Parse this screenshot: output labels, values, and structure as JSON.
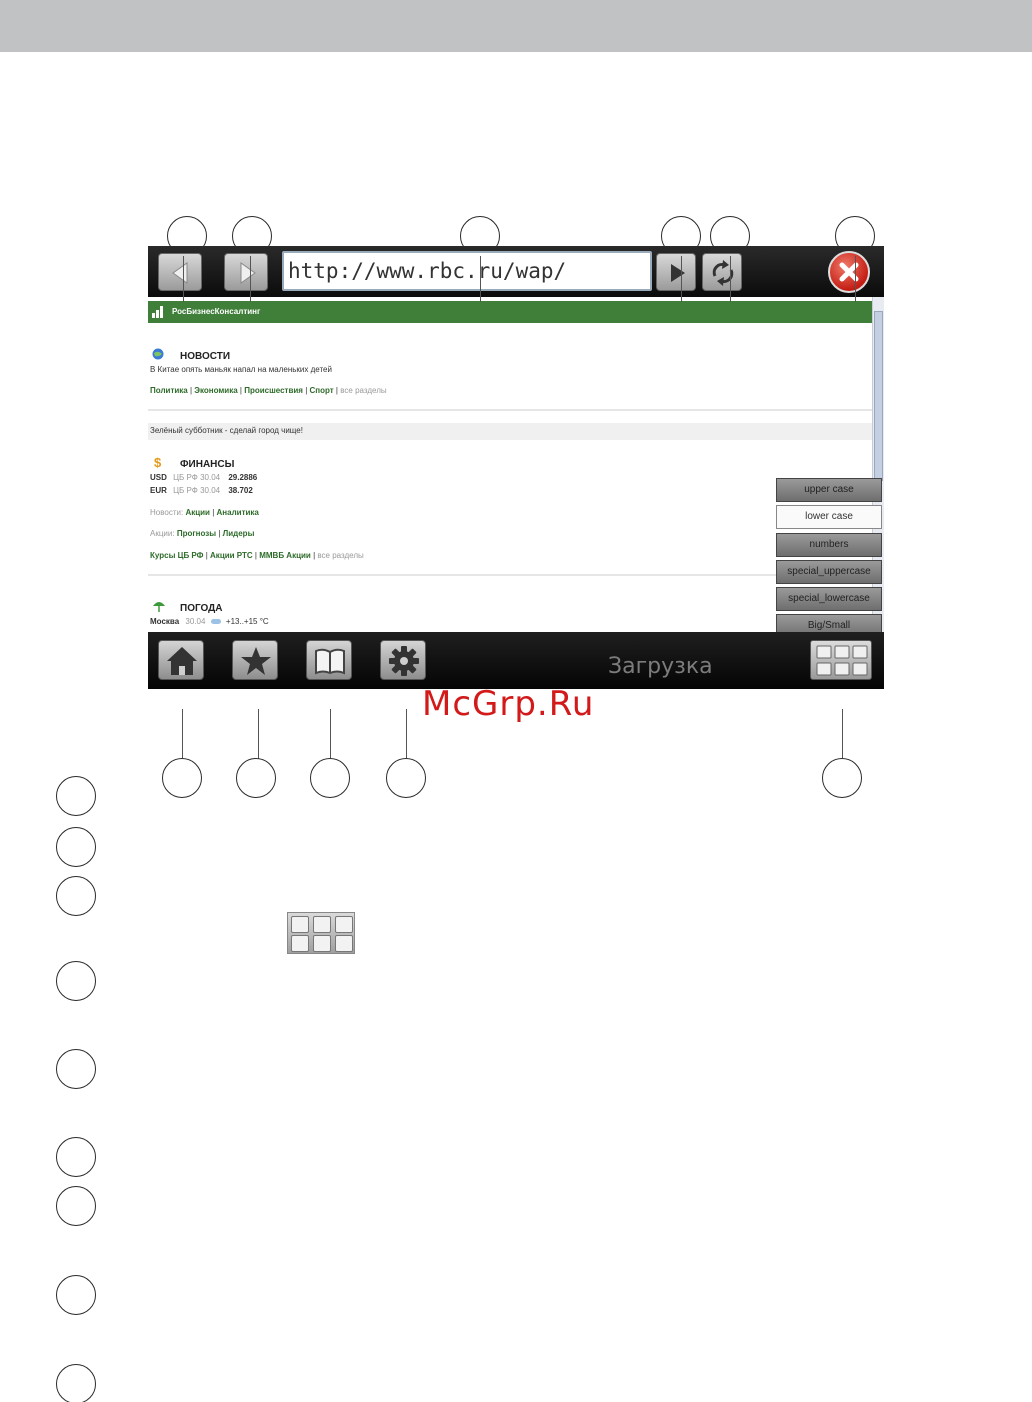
{
  "browser": {
    "url": "http://www.rbc.ru/wap/",
    "brand_name": "РосБизнесКонсалтинг",
    "news": {
      "title": "НОВОСТИ",
      "headline": "В Китае опять маньяк напал на маленьких детей",
      "links": [
        "Политика",
        "Экономика",
        "Происшествия",
        "Спорт"
      ],
      "all_sections": "все разделы"
    },
    "banner": "Зелёный субботник - сделай город чище!",
    "finance": {
      "title": "ФИНАНСЫ",
      "rates": [
        {
          "code": "USD",
          "source": "ЦБ РФ 30.04",
          "value": "29.2886"
        },
        {
          "code": "EUR",
          "source": "ЦБ РФ 30.04",
          "value": "38.702"
        }
      ],
      "news_label": "Новости:",
      "news_links": [
        "Акции",
        "Аналитика"
      ],
      "stocks_label": "Акции:",
      "stocks_links": [
        "Прогнозы",
        "Лидеры"
      ],
      "more_links": [
        "Курсы ЦБ РФ",
        "Акции РТС",
        "ММВБ Акции"
      ],
      "all_sections": "все разделы"
    },
    "weather": {
      "title": "ПОГОДА",
      "city": "Москва",
      "date": "30.04",
      "temp": "+13..+15 °C"
    },
    "keyboard_menu": [
      "upper case",
      "lower case",
      "numbers",
      "special_uppercase",
      "special_lowercase",
      "Big/Small"
    ],
    "keyboard_menu_selected": "lower case",
    "status": "Загрузка"
  },
  "watermark": "McGrp.Ru",
  "icons": {
    "back": "back-arrow-icon",
    "forward": "forward-arrow-icon",
    "go": "play-icon",
    "refresh": "refresh-icon",
    "close": "close-icon",
    "home": "home-icon",
    "favorites": "star-icon",
    "bookmarks": "book-icon",
    "settings": "gear-icon",
    "keyboard": "keyboard-icon"
  },
  "colors": {
    "brand_green": "#3f7f3a",
    "watermark_red": "#d21a1a",
    "close_red": "#c41e14"
  }
}
